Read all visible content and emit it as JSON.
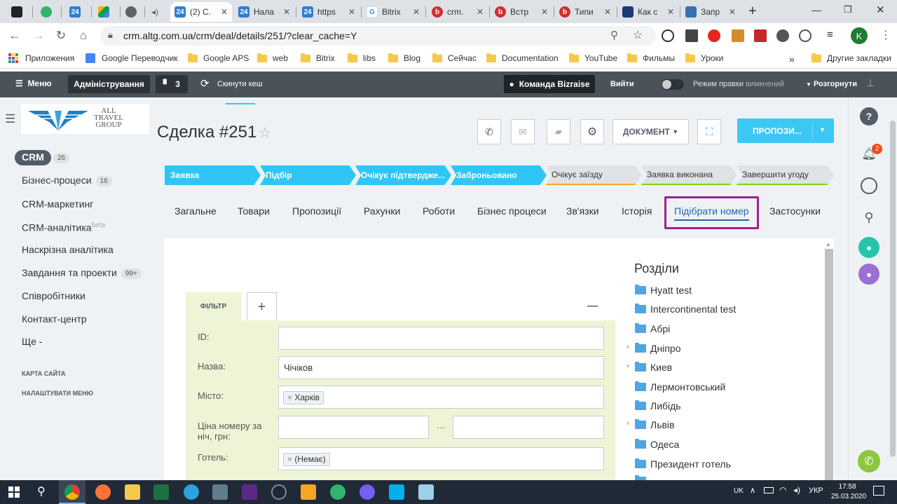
{
  "tabs": [
    {
      "label": "",
      "active": false
    },
    {
      "label": "",
      "active": false
    },
    {
      "label": "",
      "active": false
    },
    {
      "label": "",
      "active": false
    },
    {
      "label": "",
      "active": false
    },
    {
      "label": "(2) С.",
      "active": true
    },
    {
      "label": "Нала",
      "active": false
    },
    {
      "label": "https",
      "active": false
    },
    {
      "label": "Bitrix",
      "active": false
    },
    {
      "label": "crm.",
      "active": false
    },
    {
      "label": "Встр",
      "active": false
    },
    {
      "label": "Типи",
      "active": false
    },
    {
      "label": "Как с",
      "active": false
    },
    {
      "label": "Запр",
      "active": false
    }
  ],
  "browser": {
    "url": "crm.altg.com.ua/crm/deal/details/251/?clear_cache=Y",
    "profile_initial": "K"
  },
  "bookmarks": [
    "Приложения",
    "Google Переводчик",
    "Google APS",
    "web",
    "Bitrix",
    "libs",
    "Blog",
    "Сейчас",
    "Documentation",
    "YouTube",
    "Фильмы",
    "Уроки"
  ],
  "bookmarks_more": "»",
  "bookmarks_other": "Другие закладки",
  "adminbar": {
    "menu": "Меню",
    "admin": "Адміністрування",
    "count": "3",
    "reset_cache": "Скинути кеш",
    "team": "Команда Bizraise",
    "logout": "Вийти",
    "edit_mode": "Режим правки",
    "edit_mode_state": "вимкнений",
    "expand": "Розгорнути"
  },
  "logo": {
    "line1": "ALL",
    "line2": "TRAVEL",
    "line3": "GROUP"
  },
  "leftnav": {
    "crm": "CRM",
    "crm_count": "26",
    "items": [
      {
        "label": "Бізнес-процеси",
        "count": "16"
      },
      {
        "label": "CRM-маркетинг",
        "count": ""
      },
      {
        "label": "CRM-аналітика",
        "sup": "beta",
        "count": ""
      },
      {
        "label": "Наскрізна аналітика",
        "count": ""
      },
      {
        "label": "Завдання та проекти",
        "count": "99+"
      },
      {
        "label": "Співробітники",
        "count": ""
      },
      {
        "label": "Контакт-центр",
        "count": ""
      },
      {
        "label": "Ще -",
        "count": ""
      }
    ],
    "sitemap": "КАРТА САЙТА",
    "setup_menu": "НАЛАШТУВАТИ МЕНЮ"
  },
  "deal": {
    "title": "Сделка #251",
    "document_btn": "ДОКУМЕНТ",
    "propose_btn": "ПРОПОЗИ...",
    "stages": [
      {
        "label": "Заявка",
        "done": true
      },
      {
        "label": "Підбір",
        "done": true
      },
      {
        "label": "Очікує підтвердже...",
        "done": true
      },
      {
        "label": "Заброньовано",
        "done": true
      },
      {
        "label": "Очікує заїзду",
        "done": false
      },
      {
        "label": "Заявка виконана",
        "done": false
      },
      {
        "label": "Завершити угоду",
        "done": false
      }
    ],
    "tabs": [
      "Загальне",
      "Товари",
      "Пропозиції",
      "Рахунки",
      "Роботи",
      "Бізнес процеси",
      "Зв'язки",
      "Історія",
      "Підібрати номер",
      "Застосунки"
    ],
    "active_tab": "Підібрати номер"
  },
  "filter": {
    "tab_label": "ФІЛЬТР",
    "add": "+",
    "collapse": "—",
    "fields": [
      {
        "label": "ID:",
        "value": ""
      },
      {
        "label": "Назва:",
        "value": "Чічіков"
      },
      {
        "label": "Місто:",
        "chip": "Харків"
      },
      {
        "label": "Ціна номеру за ніч, грн:",
        "from": "",
        "to": "",
        "range_sep": "…"
      },
      {
        "label": "Готель:",
        "chip": "(Немає)"
      }
    ],
    "chip_remove": "×"
  },
  "sections": {
    "title": "Розділи",
    "items": [
      {
        "label": "Hyatt test",
        "expandable": false
      },
      {
        "label": "Intercontinental test",
        "expandable": false
      },
      {
        "label": "Абрі",
        "expandable": false
      },
      {
        "label": "Дніпро",
        "expandable": true
      },
      {
        "label": "Киев",
        "expandable": true
      },
      {
        "label": "Лермонтовський",
        "expandable": false
      },
      {
        "label": "Либідь",
        "expandable": false
      },
      {
        "label": "Львів",
        "expandable": true
      },
      {
        "label": "Одеса",
        "expandable": false
      },
      {
        "label": "Президент готель",
        "expandable": false
      }
    ]
  },
  "rightbar": {
    "notifications": "2"
  },
  "taskbar": {
    "lang_short": "UK",
    "lang": "УКР",
    "time": "17:58",
    "date": "25.03.2020"
  },
  "colors": {
    "stage_done": "#2fc6f6",
    "stage_future": "#e0e3e6",
    "highlight": "#a0208e",
    "filter_bg": "#eef5d6",
    "propose": "#3bc8f5"
  }
}
